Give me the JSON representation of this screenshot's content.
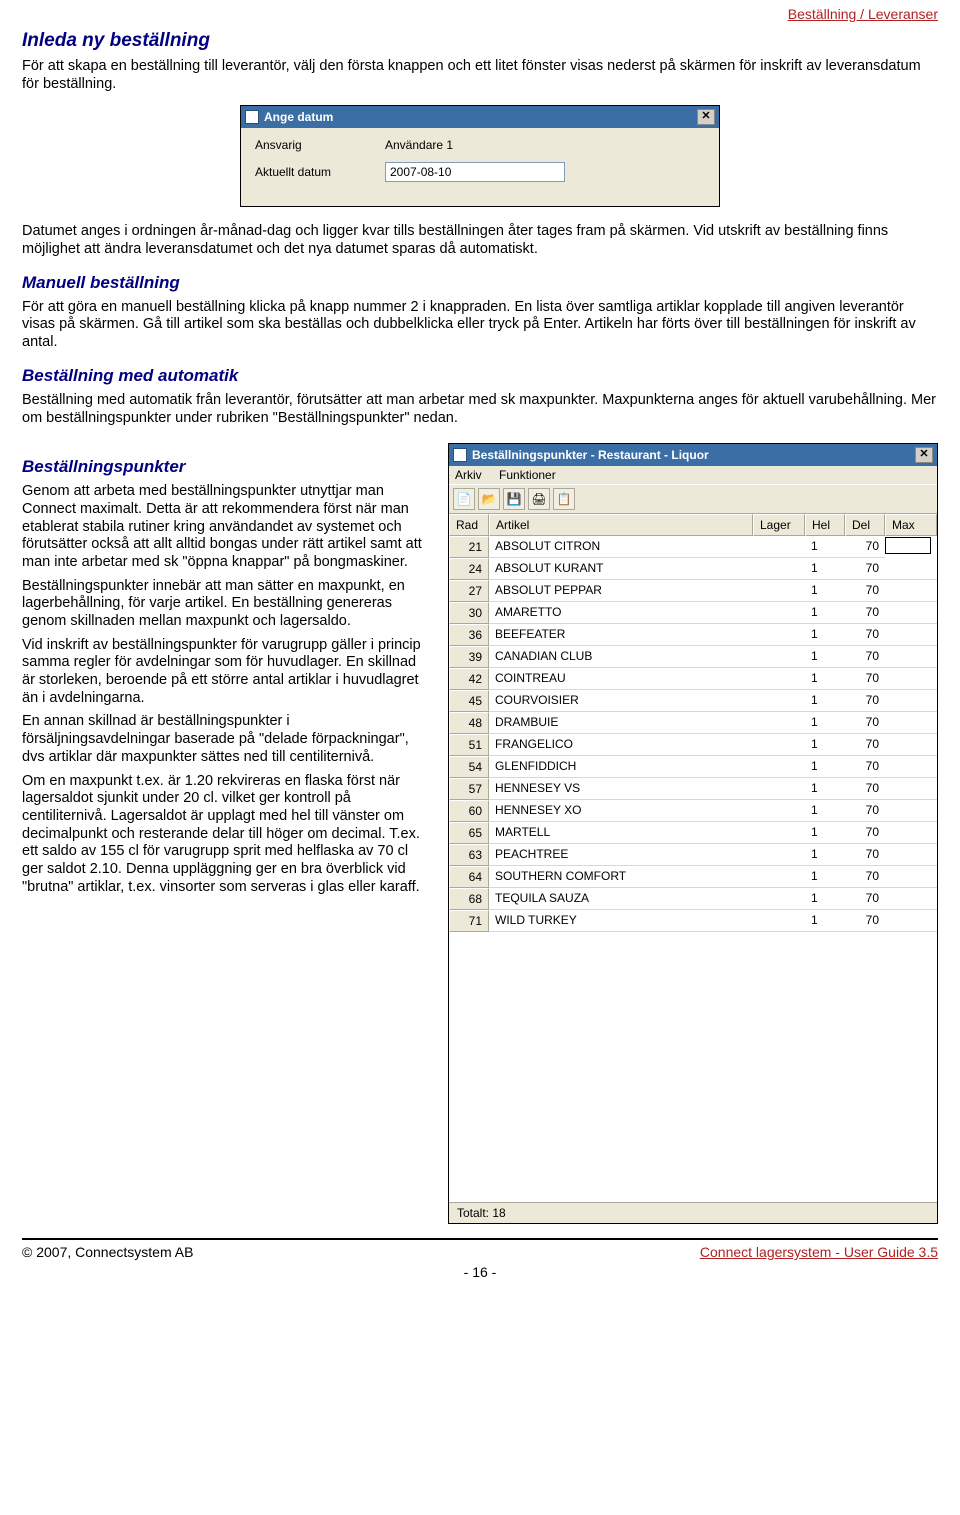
{
  "breadcrumb": "Beställning / Leveranser",
  "sections": {
    "s1_title": "Inleda ny beställning",
    "s1_p1": "För att skapa en beställning till leverantör, välj den första knappen och ett litet fönster visas nederst på skärmen för inskrift av leveransdatum för beställning.",
    "s1_p2": "Datumet anges i ordningen år-månad-dag och ligger kvar tills beställningen åter tages fram på skärmen. Vid utskrift av beställning finns möjlighet att ändra leveransdatumet och det nya datumet sparas då automatiskt.",
    "s2_title": "Manuell beställning",
    "s2_p1": "För att göra en manuell beställning klicka på knapp nummer 2 i knappraden. En lista över samtliga artiklar kopplade till angiven leverantör visas på skärmen. Gå till artikel som ska beställas och dubbelklicka eller tryck på Enter. Artikeln har förts över till beställningen för inskrift av antal.",
    "s3_title": "Beställning med automatik",
    "s3_p1": "Beställning med automatik från leverantör, förutsätter att man arbetar med sk maxpunkter. Maxpunkterna anges för aktuell varubehållning. Mer om beställningspunkter under rubriken \"Beställningspunkter\" nedan.",
    "s4_title": "Beställningspunkter",
    "s4_p1": "Genom att arbeta med  beställningspunkter utnyttjar man Connect maximalt. Detta är att rekommendera först när man etablerat stabila rutiner kring användandet av systemet och förutsätter också att allt alltid bongas under rätt artikel samt att man inte arbetar med sk \"öppna knappar\" på bongmaskiner.",
    "s4_p2": "Beställningspunkter innebär att man sätter en maxpunkt, en lagerbehållning, för varje artikel. En beställning genereras genom skillnaden mellan maxpunkt och lagersaldo.",
    "s4_p3": "Vid inskrift av beställningspunkter för varugrupp gäller i princip samma regler för avdelningar som för huvudlager. En skillnad är storleken, beroende på ett större antal artiklar i huvudlagret än i avdelningarna.",
    "s4_p4": "En annan skillnad är beställningspunkter i försäljningsavdelningar baserade på \"delade förpackningar\", dvs artiklar där maxpunkter sättes ned till centiliternivå.",
    "s4_p5": "Om en maxpunkt t.ex. är 1.20 rekvireras en flaska först när lagersaldot sjunkit under 20 cl. vilket ger kontroll på centiliternivå. Lagersaldot är upplagt med hel till vänster om decimalpunkt och resterande delar till höger om decimal. T.ex. ett saldo av 155 cl för varugrupp sprit med helflaska av 70 cl ger saldot 2.10. Denna uppläggning ger en bra överblick vid \"brutna\" artiklar, t.ex. vinsorter som serveras i glas eller karaff."
  },
  "dlg_date": {
    "title": "Ange datum",
    "row1_label": "Ansvarig",
    "row1_value": "Användare 1",
    "row2_label": "Aktuellt datum",
    "row2_value": "2007-08-10"
  },
  "dlg_grid": {
    "title": "Beställningspunkter - Restaurant - Liquor",
    "menu": {
      "m1": "Arkiv",
      "m2": "Funktioner"
    },
    "columns": {
      "c1": "Rad",
      "c2": "Artikel",
      "c3": "Lager",
      "c4": "Hel",
      "c5": "Del",
      "c6": "Max"
    },
    "rows": [
      {
        "rad": "21",
        "artikel": "ABSOLUT CITRON",
        "lager": "",
        "hel": "1",
        "del": "70",
        "max": ""
      },
      {
        "rad": "24",
        "artikel": "ABSOLUT KURANT",
        "lager": "",
        "hel": "1",
        "del": "70",
        "max": ""
      },
      {
        "rad": "27",
        "artikel": "ABSOLUT PEPPAR",
        "lager": "",
        "hel": "1",
        "del": "70",
        "max": ""
      },
      {
        "rad": "30",
        "artikel": "AMARETTO",
        "lager": "",
        "hel": "1",
        "del": "70",
        "max": ""
      },
      {
        "rad": "36",
        "artikel": "BEEFEATER",
        "lager": "",
        "hel": "1",
        "del": "70",
        "max": ""
      },
      {
        "rad": "39",
        "artikel": "CANADIAN CLUB",
        "lager": "",
        "hel": "1",
        "del": "70",
        "max": ""
      },
      {
        "rad": "42",
        "artikel": "COINTREAU",
        "lager": "",
        "hel": "1",
        "del": "70",
        "max": ""
      },
      {
        "rad": "45",
        "artikel": "COURVOISIER",
        "lager": "",
        "hel": "1",
        "del": "70",
        "max": ""
      },
      {
        "rad": "48",
        "artikel": "DRAMBUIE",
        "lager": "",
        "hel": "1",
        "del": "70",
        "max": ""
      },
      {
        "rad": "51",
        "artikel": "FRANGELICO",
        "lager": "",
        "hel": "1",
        "del": "70",
        "max": ""
      },
      {
        "rad": "54",
        "artikel": "GLENFIDDICH",
        "lager": "",
        "hel": "1",
        "del": "70",
        "max": ""
      },
      {
        "rad": "57",
        "artikel": "HENNESEY VS",
        "lager": "",
        "hel": "1",
        "del": "70",
        "max": ""
      },
      {
        "rad": "60",
        "artikel": "HENNESEY XO",
        "lager": "",
        "hel": "1",
        "del": "70",
        "max": ""
      },
      {
        "rad": "65",
        "artikel": "MARTELL",
        "lager": "",
        "hel": "1",
        "del": "70",
        "max": ""
      },
      {
        "rad": "63",
        "artikel": "PEACHTREE",
        "lager": "",
        "hel": "1",
        "del": "70",
        "max": ""
      },
      {
        "rad": "64",
        "artikel": "SOUTHERN COMFORT",
        "lager": "",
        "hel": "1",
        "del": "70",
        "max": ""
      },
      {
        "rad": "68",
        "artikel": "TEQUILA SAUZA",
        "lager": "",
        "hel": "1",
        "del": "70",
        "max": ""
      },
      {
        "rad": "71",
        "artikel": "WILD TURKEY",
        "lager": "",
        "hel": "1",
        "del": "70",
        "max": ""
      }
    ],
    "status": "Totalt: 18"
  },
  "footer": {
    "left": "© 2007, Connectsystem AB",
    "right": "Connect lagersystem - User Guide 3.5",
    "page": "- 16 -"
  }
}
